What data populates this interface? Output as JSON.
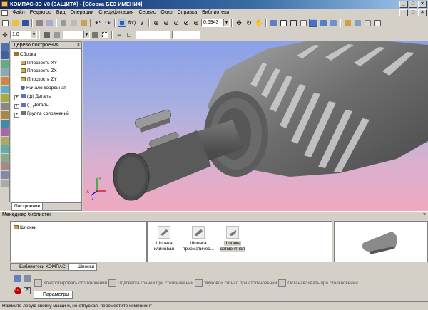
{
  "title": "КОМПАС-3D V8 (ЗАЩИТА) - [Сборка БЕЗ ИМЕНИ4]",
  "menu": [
    "Файл",
    "Редактор",
    "Вид",
    "Операции",
    "Спецификация",
    "Сервис",
    "Окно",
    "Справка",
    "Библиотеки"
  ],
  "toolbar": {
    "zoom_value": "0.6943",
    "line_width": "1.0"
  },
  "tree": {
    "title": "Дерево построения",
    "items": [
      "Сборка",
      "Плоскость XY",
      "Плоскость ZX",
      "Плоскость ZY",
      "Начало координат",
      "(ф) Деталь",
      "(-) Деталь",
      "Группа сопряжений"
    ],
    "tab": "Построение"
  },
  "library": {
    "title": "Менеджер библиотек",
    "selected": "Шпонки",
    "items": [
      "Шпонка клиновая",
      "Шпонка призматичес...",
      "Шпонка сегментная"
    ],
    "tabs": [
      "Библиотеки КОМПАС",
      "Шпонки"
    ]
  },
  "props": {
    "options": [
      "Контролировать столкновения",
      "Подсветка граней при столкновении",
      "Звуковой сигнал при столкновении",
      "Останавливать при столкновении"
    ],
    "tab": "Параметры"
  },
  "status": "Нажмите левую кнопку мыши и, не отпуская, переместите компонент",
  "axes": {
    "x": "X",
    "y": "Y",
    "z": "Z"
  },
  "colors": {
    "title_start": "#0a246a",
    "title_end": "#a6caf0",
    "gear": "#7a7a7a",
    "view_top": "#8aa0e8",
    "view_bottom": "#f0a8c0"
  }
}
